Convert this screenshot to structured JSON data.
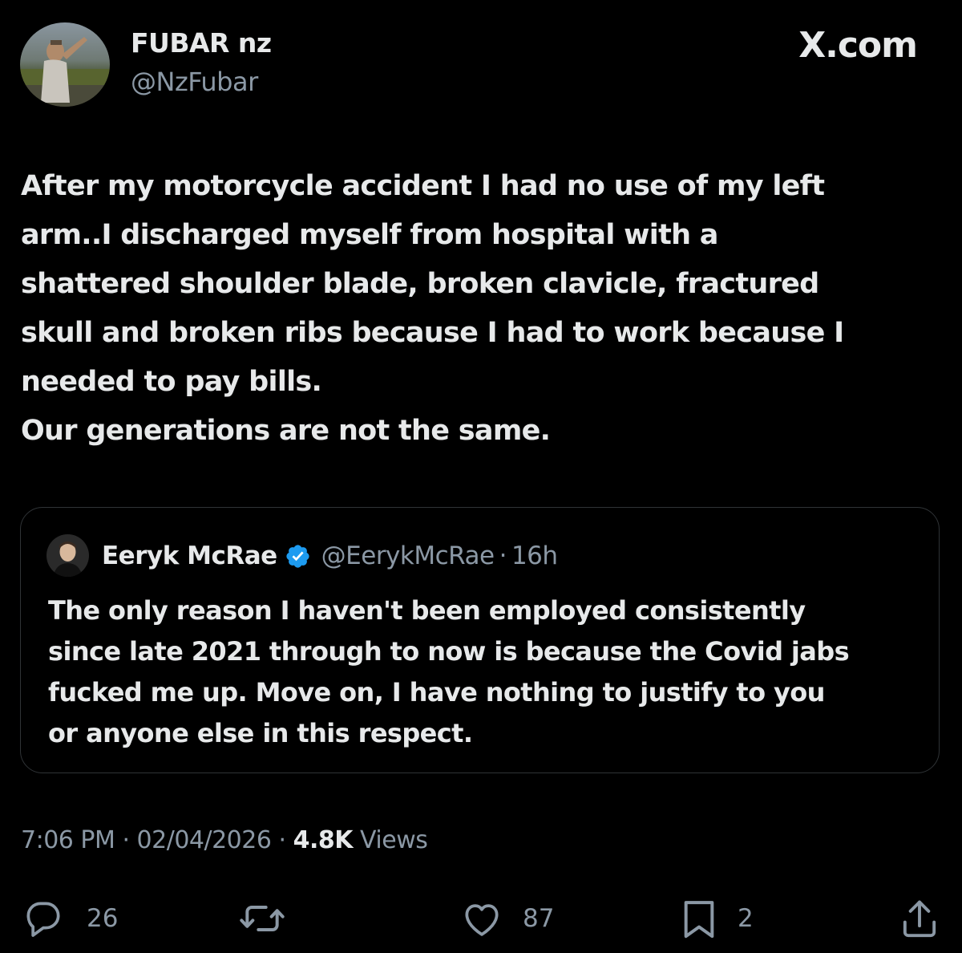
{
  "author": {
    "display_name": "FUBAR nz",
    "handle": "@NzFubar",
    "avatar_icon": "profile-photo"
  },
  "brand": {
    "watermark": "X.com"
  },
  "tweet": {
    "lines": [
      "After my motorcycle accident I had no use of my left",
      "arm..I discharged myself from hospital with a",
      "shattered shoulder blade, broken clavicle, fractured",
      "skull and broken ribs because I had to work because I",
      "needed to pay bills.",
      "Our generations are not the same."
    ]
  },
  "quoted_tweet": {
    "display_name": "Eeryk McRae",
    "verified": true,
    "verified_color": "#1d9bf0",
    "handle": "@EerykMcRae",
    "separator": "·",
    "time_ago": "16h",
    "lines": [
      "The only reason I haven't been employed consistently",
      "since late 2021 through to now is because the Covid jabs",
      "fucked me up. Move on, I have nothing to justify to you",
      "or anyone else in this respect."
    ]
  },
  "meta": {
    "time": "7:06 PM",
    "separator": "·",
    "date": "02/04/2026",
    "views_count": "4.8K",
    "views_label": "Views"
  },
  "actions": {
    "replies": "26",
    "retweets": "",
    "likes": "87",
    "bookmarks": "2",
    "icons": [
      "reply-icon",
      "retweet-icon",
      "like-icon",
      "bookmark-icon",
      "share-icon"
    ]
  },
  "colors": {
    "background": "#000000",
    "primary_text": "#e7e9ea",
    "secondary_text": "#8b98a5",
    "border": "#2f3336"
  }
}
